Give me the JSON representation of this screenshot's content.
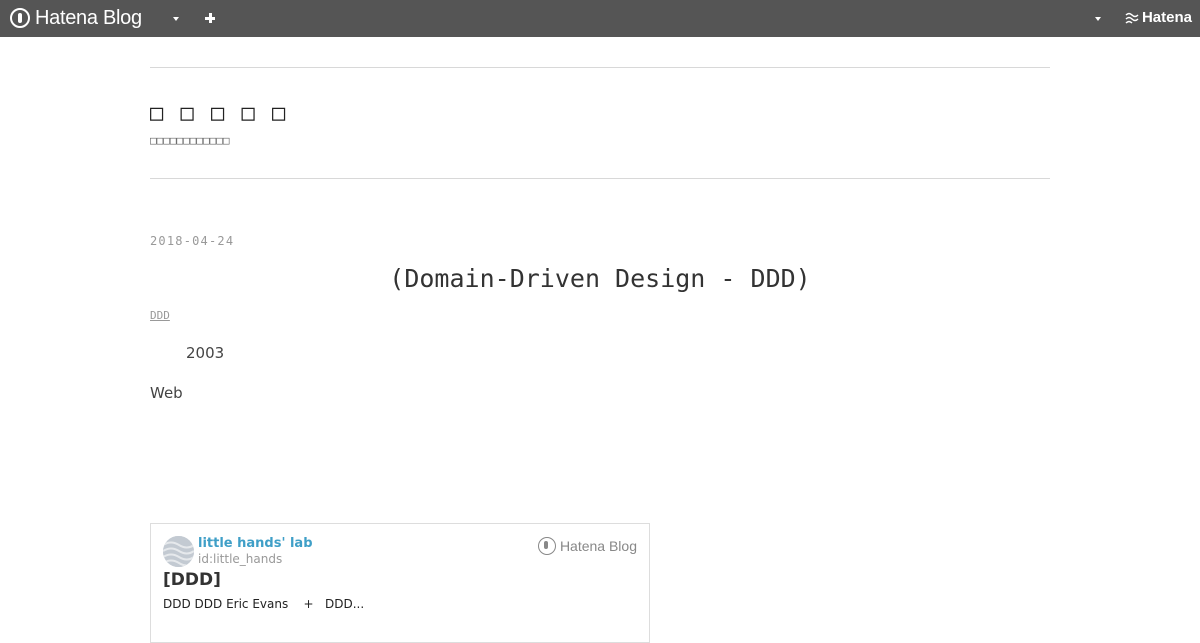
{
  "topbar": {
    "brand": "Hatena Blog",
    "hatena": "Hatena"
  },
  "blog": {
    "title": "□ □ □ □ □",
    "description": "□□□□□□□□□□□□"
  },
  "entry": {
    "date": "2018-04-24",
    "title": "(Domain-Driven Design - DDD)",
    "category": "DDD",
    "line1": "2003",
    "line2": "Web"
  },
  "embed_card": {
    "blog_name": "little hands' lab",
    "user_id": "id:little_hands",
    "service": "Hatena Blog",
    "title": "[DDD]",
    "description": "DDD DDD Eric Evans    +   DDD..."
  },
  "colors": {
    "topbar": "#555555",
    "link_blue": "#3f9fc7",
    "divider": "#d8d8d8"
  },
  "icons": {
    "brand": "hatena-blog-logo-icon",
    "caret": "caret-down-icon",
    "plus": "plus-icon",
    "hatena": "hatena-logo-icon"
  }
}
